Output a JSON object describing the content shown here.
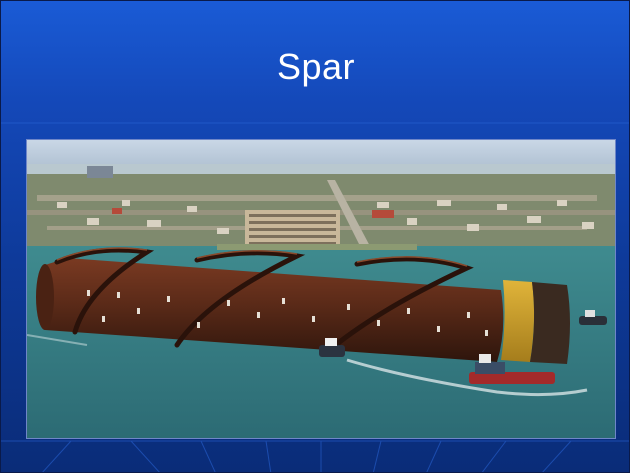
{
  "slide": {
    "title": "Spar",
    "background_color": "#1448b8",
    "accent_color": "#ffffff"
  },
  "photo": {
    "subject": "spar-hull-aerial-photo"
  }
}
